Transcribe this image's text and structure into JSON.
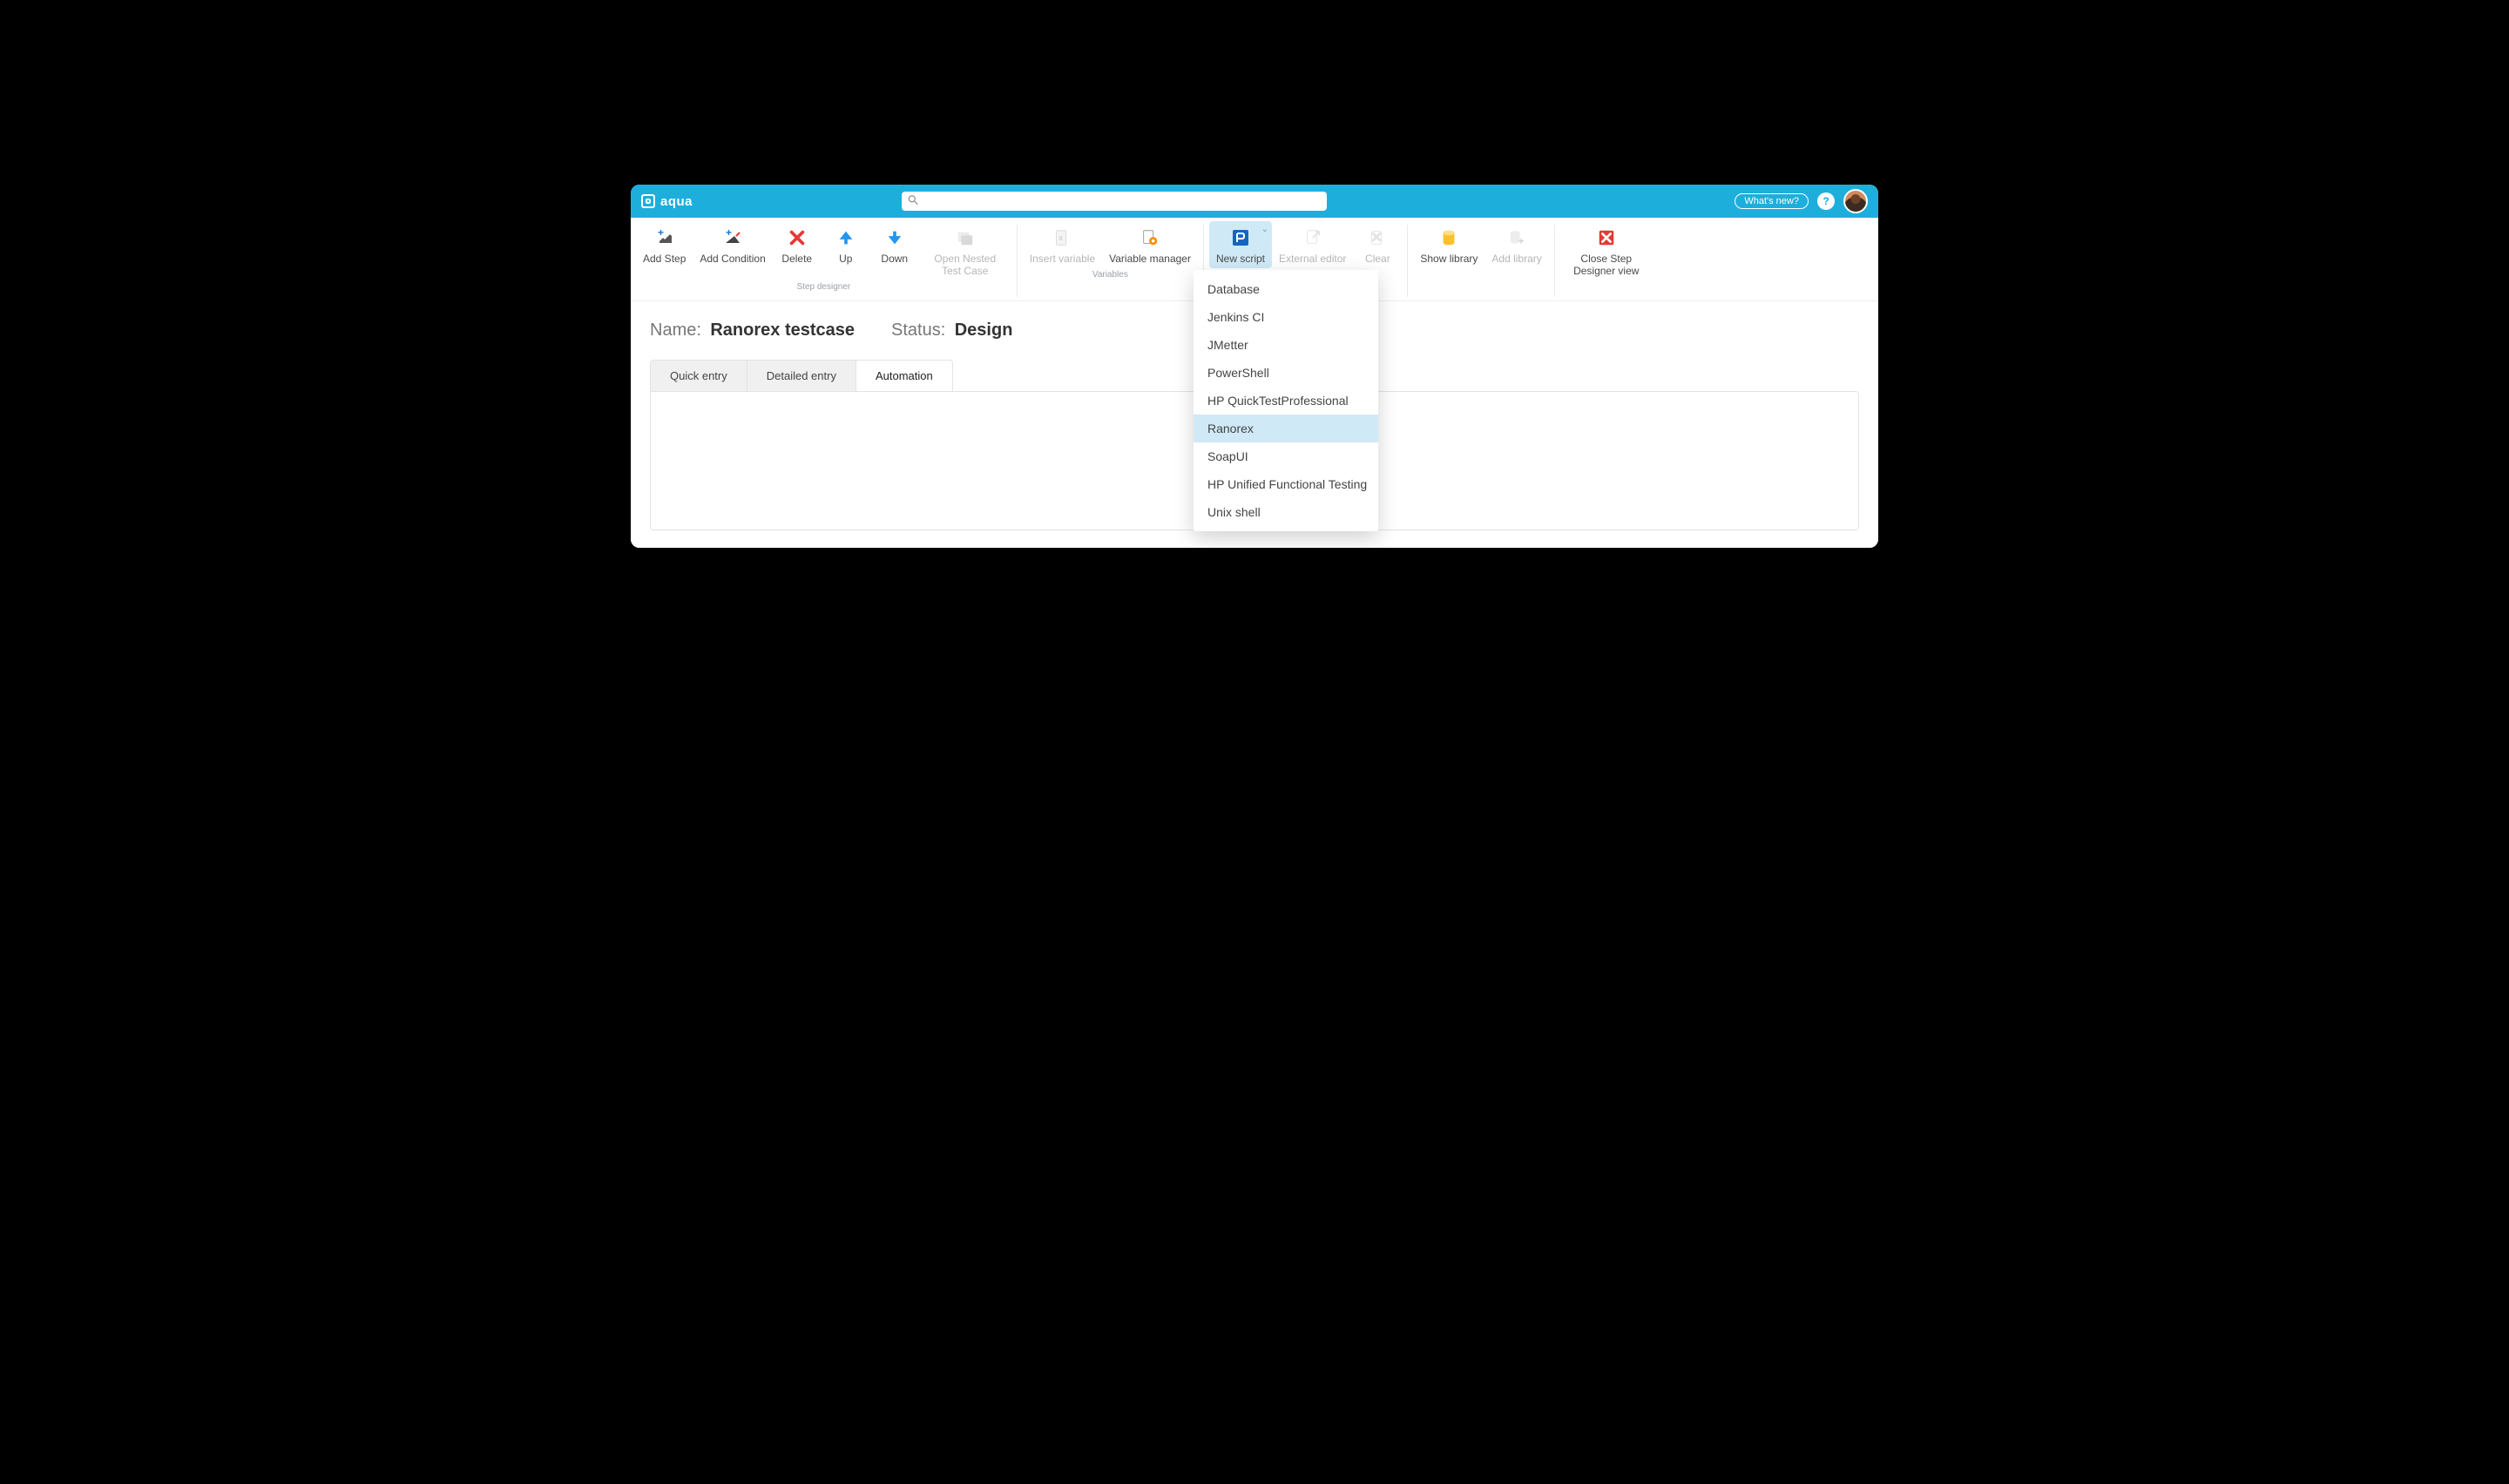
{
  "header": {
    "brand": "aqua",
    "search_placeholder": "",
    "whats_new": "What's new?",
    "help": "?"
  },
  "ribbon": {
    "groups": {
      "step_designer": {
        "label": "Step designer",
        "add_step": "Add Step",
        "add_condition": "Add Condition",
        "delete": "Delete",
        "up": "Up",
        "down": "Down",
        "open_nested": "Open Nested Test Case"
      },
      "variables": {
        "label": "Variables",
        "insert_variable": "Insert variable",
        "variable_manager": "Variable manager"
      },
      "script": {
        "new_script": "New script",
        "external_editor": "External editor",
        "clear": "Clear"
      },
      "library": {
        "show_library": "Show library",
        "add_library": "Add library"
      },
      "close": "Close Step Designer view"
    }
  },
  "main": {
    "name_label": "Name:",
    "name_value": "Ranorex testcase",
    "status_label": "Status:",
    "status_value": "Design",
    "tabs": {
      "quick": "Quick entry",
      "detailed": "Detailed entry",
      "automation": "Automation"
    }
  },
  "dropdown": {
    "items": [
      "Database",
      "Jenkins CI",
      "JMetter",
      "PowerShell",
      "HP QuickTestProfessional",
      "Ranorex",
      "SoapUI",
      "HP Unified Functional Testing",
      "Unix shell"
    ],
    "selected_index": 5
  }
}
